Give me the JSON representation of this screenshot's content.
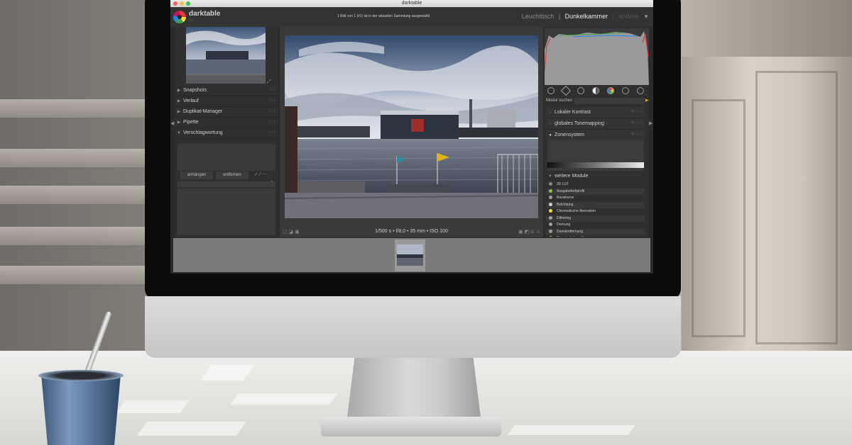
{
  "window": {
    "title": "darktable"
  },
  "app": {
    "name": "darktable",
    "version": "2.0"
  },
  "header": {
    "status": "1 Bild von 1 (#1) ist in der aktuellen Sammlung ausgewählt",
    "views": {
      "lighttable": "Leuchttisch",
      "separator": "|",
      "darkroom": "Dunkelkammer",
      "other": "andere"
    }
  },
  "left_panel": {
    "modules": [
      {
        "label": "Snapshots"
      },
      {
        "label": "Verlauf"
      },
      {
        "label": "Duplikat-Manager"
      },
      {
        "label": "Pipette"
      },
      {
        "label": "Verschlagwortung"
      }
    ],
    "tag_buttons": {
      "attach": "anhängen",
      "detach": "entfernen"
    }
  },
  "center": {
    "exif": "1/500 s • f/8,0 • 35 mm • ISO 100"
  },
  "right_panel": {
    "search_label": "Modul suchen",
    "modules": [
      {
        "label": "Lokaler Kontrast"
      },
      {
        "label": "globales Tonemapping"
      },
      {
        "label": "Zonensystem"
      }
    ],
    "more_modules_label": "weitere Module",
    "more_modules": [
      {
        "label": "3D LUT",
        "color": "#888888"
      },
      {
        "label": "Ausgabefarbprofil",
        "color": "#8bc34a"
      },
      {
        "label": "Basiskurve",
        "color": "#9e9e9e"
      },
      {
        "label": "Belichtung",
        "color": "#cfcfcf"
      },
      {
        "label": "Chromatische Aberration",
        "color": "#fdd835"
      },
      {
        "label": "Dithering",
        "color": "#9e9e9e"
      },
      {
        "label": "Drehung",
        "color": "#9e9e9e"
      },
      {
        "label": "Dunstentfernung",
        "color": "#9e9e9e"
      },
      {
        "label": "Eingabefarbprofil",
        "color": "#8bc34a"
      }
    ]
  },
  "colors": {
    "accent": "#f9a825",
    "panel": "#2f2f2f",
    "desk": "#e6e6e3"
  }
}
